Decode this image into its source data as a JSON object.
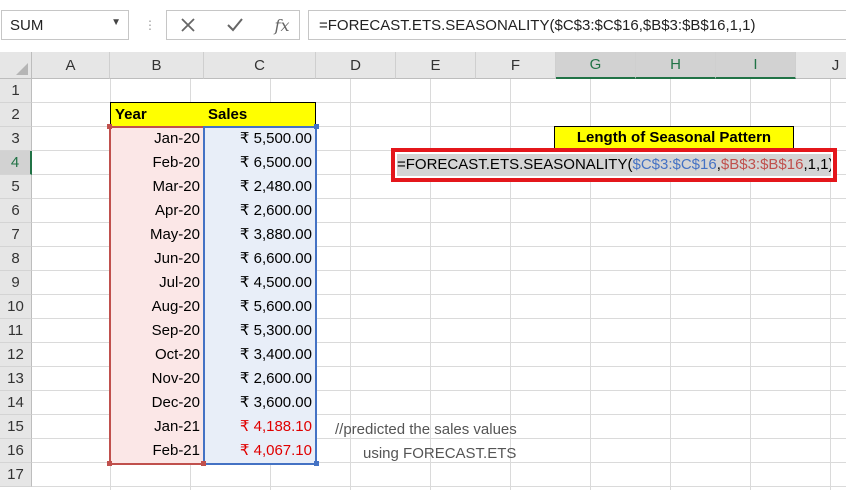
{
  "formula_bar": {
    "name_box": "SUM",
    "cancel_icon": "close-icon",
    "enter_icon": "check-icon",
    "fx_label": "fx",
    "formula": "=FORECAST.ETS.SEASONALITY($C$3:$C$16,$B$3:$B$16,1,1)"
  },
  "columns": [
    "A",
    "B",
    "C",
    "D",
    "E",
    "F",
    "G",
    "H",
    "I",
    "J"
  ],
  "rows": [
    "1",
    "2",
    "3",
    "4",
    "5",
    "6",
    "7",
    "8",
    "9",
    "10",
    "11",
    "12",
    "13",
    "14",
    "15",
    "16",
    "17"
  ],
  "table": {
    "headers": {
      "year": "Year",
      "sales": "Sales"
    },
    "rows": [
      {
        "year": "Jan-20",
        "sales": "₹ 5,500.00"
      },
      {
        "year": "Feb-20",
        "sales": "₹ 6,500.00"
      },
      {
        "year": "Mar-20",
        "sales": "₹ 2,480.00"
      },
      {
        "year": "Apr-20",
        "sales": "₹ 2,600.00"
      },
      {
        "year": "May-20",
        "sales": "₹ 3,880.00"
      },
      {
        "year": "Jun-20",
        "sales": "₹ 6,600.00"
      },
      {
        "year": "Jul-20",
        "sales": "₹ 4,500.00"
      },
      {
        "year": "Aug-20",
        "sales": "₹ 5,600.00"
      },
      {
        "year": "Sep-20",
        "sales": "₹ 5,300.00"
      },
      {
        "year": "Oct-20",
        "sales": "₹ 3,400.00"
      },
      {
        "year": "Nov-20",
        "sales": "₹ 2,600.00"
      },
      {
        "year": "Dec-20",
        "sales": "₹ 3,600.00"
      },
      {
        "year": "Jan-21",
        "sales": "₹ 4,188.10"
      },
      {
        "year": "Feb-21",
        "sales": "₹ 4,067.10"
      }
    ]
  },
  "seasonal": {
    "label": "Length of Seasonal Pattern",
    "formula_parts": {
      "prefix": "=FORECAST.ETS.SEASONALITY(",
      "ref_values": "$C$3:$C$16",
      "comma1": ",",
      "ref_timeline": "$B$3:$B$16",
      "suffix": ",1,1)"
    }
  },
  "note": {
    "line1": "//predicted the sales values",
    "line2": "using FORECAST.ETS"
  },
  "colors": {
    "header_fill": "#ffff00",
    "edit_highlight": "#e4161b",
    "forecast_text": "#e00000",
    "range_b": "#c0504d",
    "range_c": "#4472c4",
    "excel_green": "#217346"
  }
}
